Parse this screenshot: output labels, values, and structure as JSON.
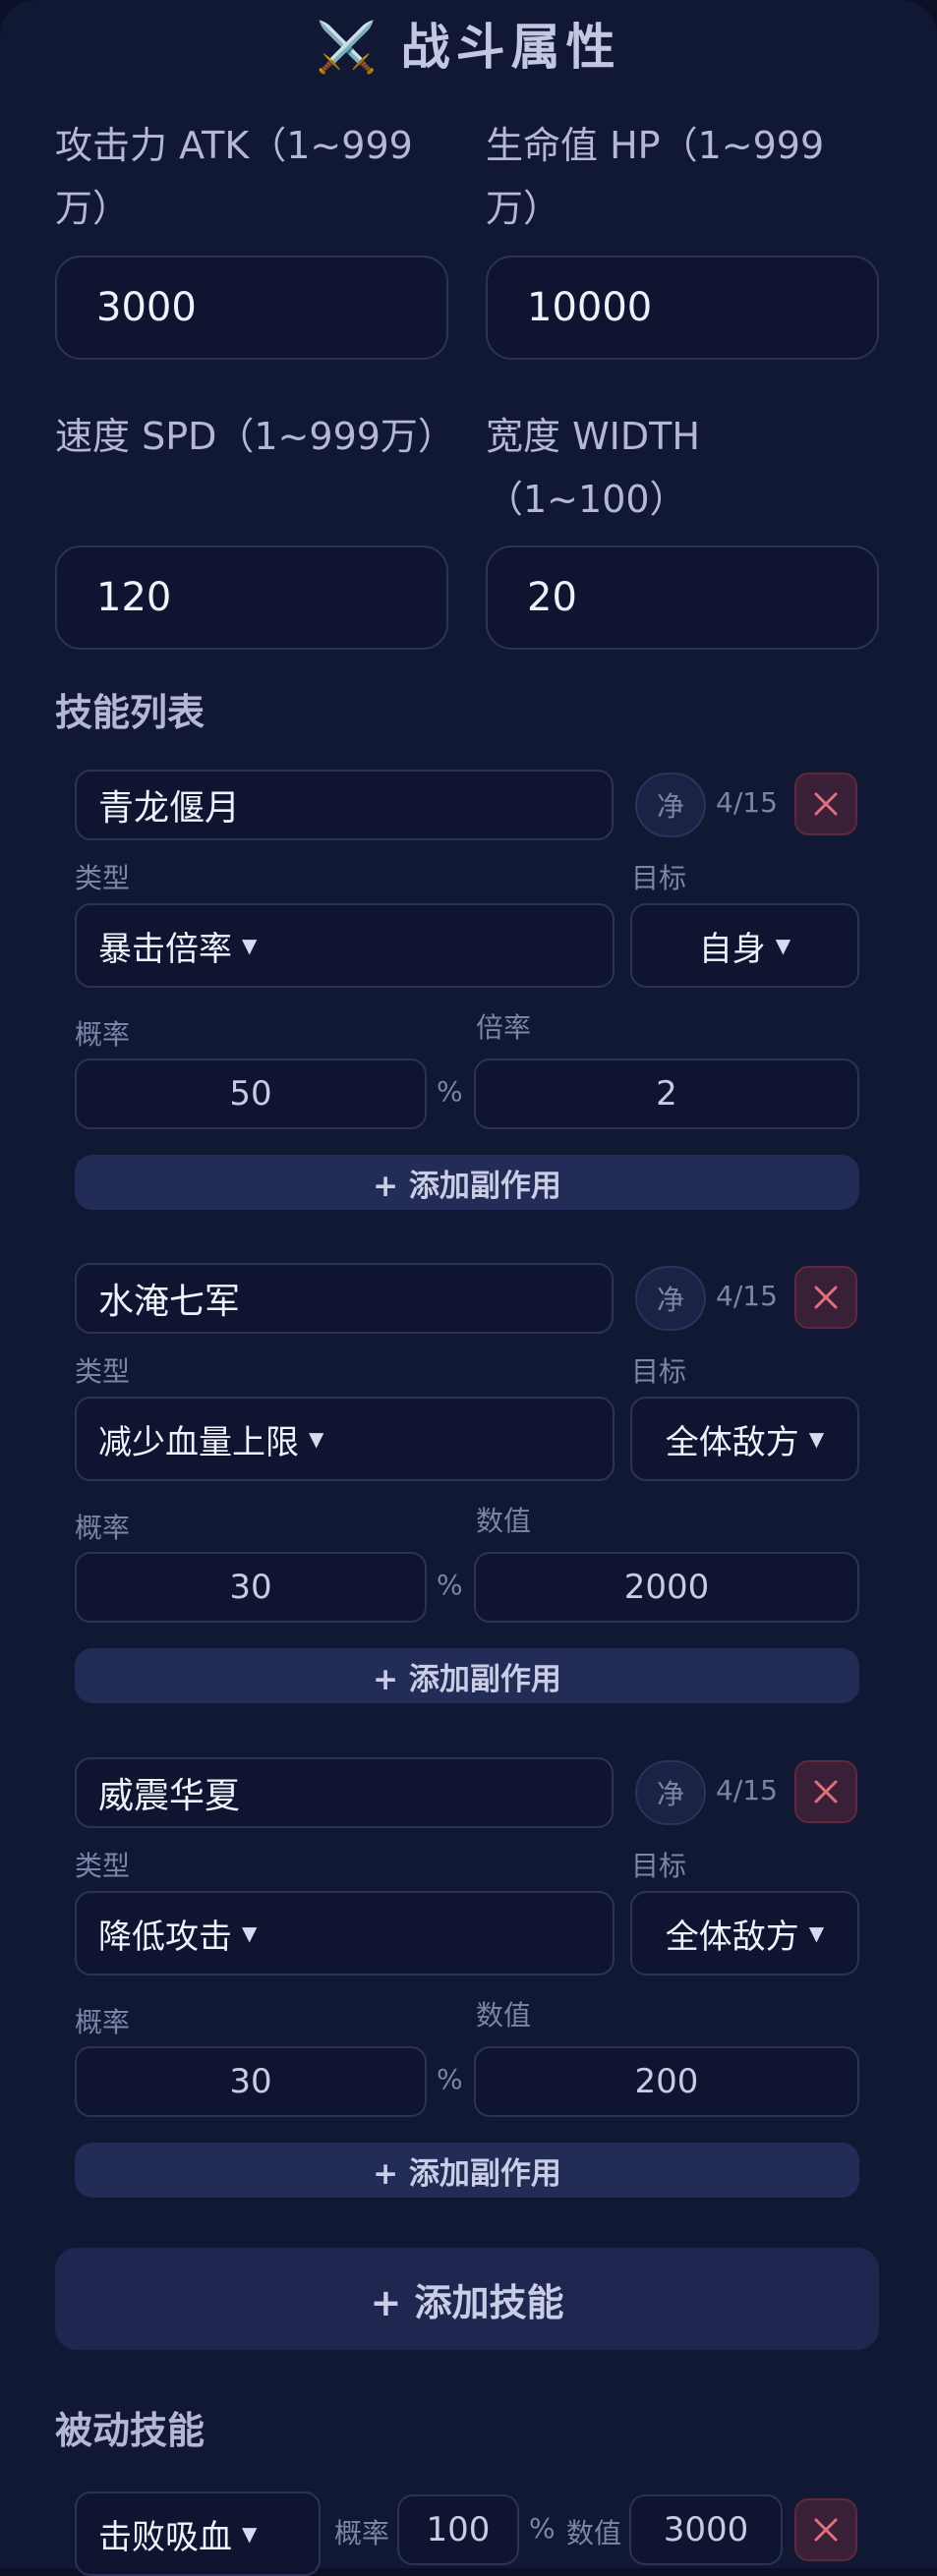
{
  "header": {
    "icon": "crossed-swords-icon",
    "title": "战斗属性"
  },
  "stats": {
    "atk": {
      "label": "攻击力 ATK（1~999万）",
      "value": "3000"
    },
    "hp": {
      "label": "生命值 HP（1~999万）",
      "value": "10000"
    },
    "spd": {
      "label": "速度 SPD（1~999万）",
      "value": "120"
    },
    "width": {
      "label": "宽度 WIDTH（1~100）",
      "value": "20"
    }
  },
  "skills_title": "技能列表",
  "labels": {
    "type": "类型",
    "target": "目标",
    "prob": "概率",
    "percent": "%",
    "purify": "净"
  },
  "skills": [
    {
      "name": "青龙偃月",
      "count": "4/15",
      "type": "暴击倍率",
      "target": "自身",
      "prob": "50",
      "value_label": "倍率",
      "value": "2",
      "add_effect": "+ 添加副作用"
    },
    {
      "name": "水淹七军",
      "count": "4/15",
      "type": "减少血量上限",
      "target": "全体敌方",
      "prob": "30",
      "value_label": "数值",
      "value": "2000",
      "add_effect": "+ 添加副作用"
    },
    {
      "name": "威震华夏",
      "count": "4/15",
      "type": "降低攻击",
      "target": "全体敌方",
      "prob": "30",
      "value_label": "数值",
      "value": "200",
      "add_effect": "+ 添加副作用"
    }
  ],
  "add_skill": "+ 添加技能",
  "passive": {
    "title": "被动技能",
    "items": [
      {
        "type": "击败吸血",
        "prob_label": "概率",
        "prob": "100",
        "percent": "%",
        "value_label": "数值",
        "value": "3000"
      }
    ]
  }
}
